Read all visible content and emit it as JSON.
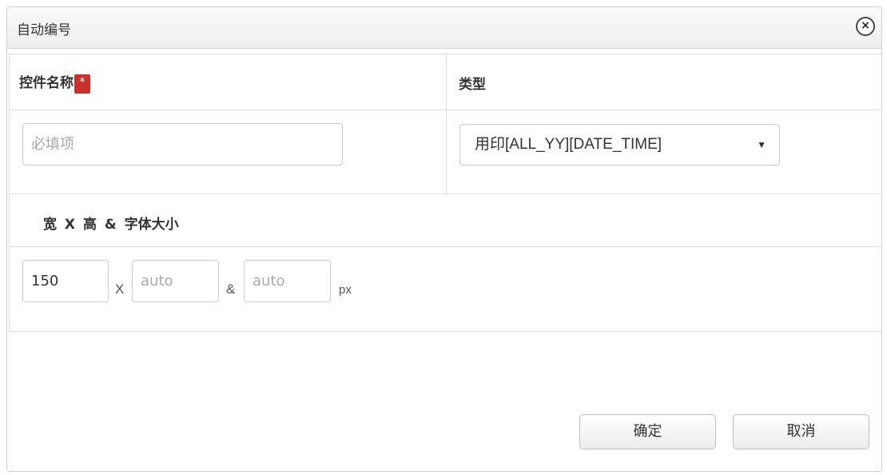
{
  "dialog": {
    "title": "自动编号",
    "close_label": "×"
  },
  "form": {
    "name_label": "控件名称",
    "required_marker": "*",
    "type_label": "类型",
    "name_input": {
      "value": "",
      "placeholder": "必填项"
    },
    "type_select": {
      "selected": "用印[ALL_YY][DATE_TIME]",
      "arrow": "▼"
    },
    "size_label": "宽 X 高 & 字体大小",
    "width_input": {
      "value": "150",
      "placeholder": ""
    },
    "times_sep": "X",
    "height_input": {
      "value": "",
      "placeholder": "auto"
    },
    "amp_sep": "&",
    "font_input": {
      "value": "",
      "placeholder": "auto"
    },
    "unit": "px"
  },
  "footer": {
    "ok_label": "确定",
    "cancel_label": "取消"
  }
}
